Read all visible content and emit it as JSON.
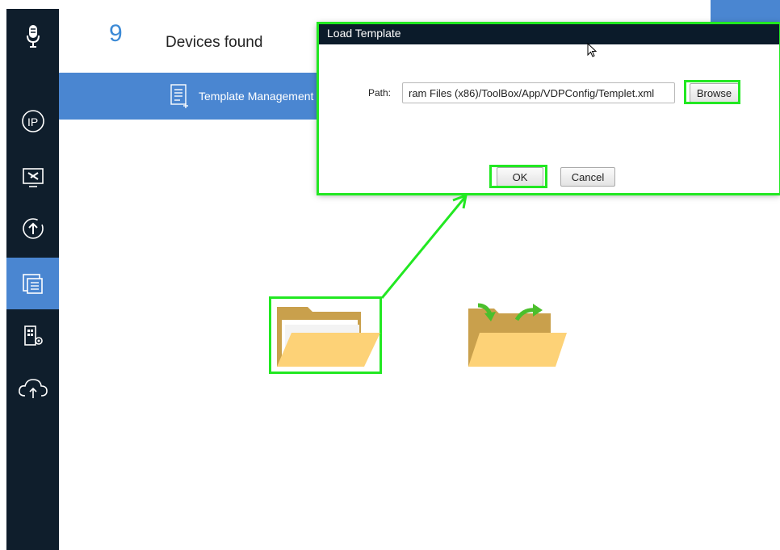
{
  "header": {
    "device_count": "9",
    "devices_label": "Devices found"
  },
  "toolbar": {
    "template_tab_label": "Template Management"
  },
  "sidebar": {
    "items": [
      {
        "icon": "microphone-icon"
      },
      {
        "icon": "ip-icon"
      },
      {
        "icon": "tools-monitor-icon"
      },
      {
        "icon": "upgrade-icon"
      },
      {
        "icon": "template-icon",
        "active": true
      },
      {
        "icon": "building-settings-icon"
      },
      {
        "icon": "cloud-upload-icon"
      }
    ]
  },
  "dialog": {
    "title": "Load Template",
    "path_label": "Path:",
    "path_value": "ram Files (x86)/ToolBox/App/VDPConfig/Templet.xml",
    "browse_label": "Browse",
    "ok_label": "OK",
    "cancel_label": "Cancel"
  },
  "content": {
    "items": [
      {
        "icon": "open-folder-icon"
      },
      {
        "icon": "folder-transfer-icon"
      }
    ]
  },
  "colors": {
    "sidebar_bg": "#0f1e2c",
    "accent_blue": "#4a86d1",
    "highlight_green": "#22e822",
    "folder_back": "#c9a04c",
    "folder_front": "#fdd277",
    "transfer_arrow_green": "#4bbf2c"
  }
}
